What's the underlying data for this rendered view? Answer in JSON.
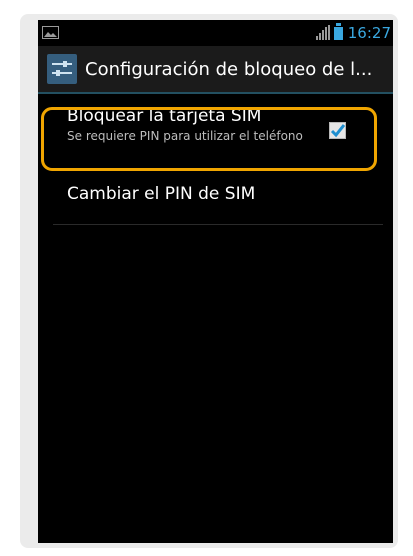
{
  "status_bar": {
    "time": "16:27",
    "icons": [
      "notification-image-icon",
      "signal-icon",
      "battery-icon"
    ]
  },
  "action_bar": {
    "icon": "settings-sliders-icon",
    "title": "Configuración de bloqueo de l..."
  },
  "preferences": {
    "lock_sim": {
      "title": "Bloquear la tarjeta SIM",
      "summary": "Se requiere PIN para utilizar el teléfono",
      "checked": true
    },
    "change_pin": {
      "title": "Cambiar el PIN de SIM"
    }
  },
  "colors": {
    "accent": "#33b5e5",
    "highlight": "#f0a500",
    "background": "#000000"
  }
}
